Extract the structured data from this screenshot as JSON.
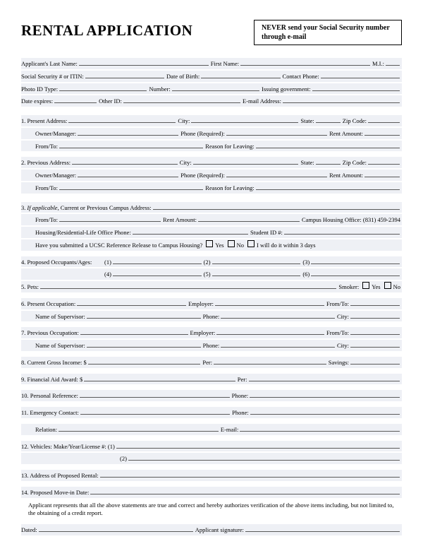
{
  "header": {
    "title": "RENTAL APPLICATION",
    "warning": "NEVER send your Social Security number through e-mail"
  },
  "labels": {
    "last_name": "Applicant's Last Name:",
    "first_name": "First Name:",
    "mi": "M.I.:",
    "ssn": "Social Security # or ITIN:",
    "dob": "Date of Birth:",
    "contact_phone": "Contact Phone:",
    "photo_id": "Photo ID Type:",
    "number": "Number:",
    "issuing_gov": "Issuing government:",
    "date_expires": "Date expires:",
    "other_id": "Other ID:",
    "email": "E-mail Address:",
    "s1": "1. Present Address:",
    "s2": "2. Previous Address:",
    "city": "City:",
    "state": "State:",
    "zip": "Zip Code:",
    "owner_manager": "Owner/Manager:",
    "phone_req": "Phone (Required):",
    "rent_amount": "Rent Amount:",
    "from_to": "From/To:",
    "reason": "Reason for Leaving:",
    "s3_prefix": "3.",
    "s3_italic": " If applicable,",
    "s3_rest": " Current or Previous Campus Address:",
    "campus_office": "Campus Housing Office: (831) 459-2394",
    "housing_phone": "Housing/Residential-Life Office Phone:",
    "student_id": "Student ID #:",
    "ref_release": "Have you submitted a UCSC Reference Release to Campus Housing?",
    "yes": "Yes",
    "no": "No",
    "within3": "I will do it within 3 days",
    "s4": "4. Proposed Occupants/Ages:",
    "occ1": "(1)",
    "occ2": "(2)",
    "occ3": "(3)",
    "occ4": "(4)",
    "occ5": "(5)",
    "occ6": "(6)",
    "s5": "5. Pets:",
    "smoker": "Smoker:",
    "s6": "6. Present Occupation:",
    "s7": "7. Previous Occupation:",
    "employer": "Employer:",
    "supervisor": "Name of Supervisor:",
    "phone": "Phone:",
    "city2": "City:",
    "s8": "8. Current Gross Income: $",
    "per": "Per:",
    "savings": "Savings:",
    "s9": "9. Financial Aid Award: $",
    "s10": "10. Personal Reference:",
    "s11": "11. Emergency Contact:",
    "relation": "Relation:",
    "email2": "E-mail:",
    "s12": "12. Vehicles: Make/Year/License #: (1)",
    "s12b": "(2)",
    "s13": "13. Address of Proposed Rental:",
    "s14": "14. Proposed Move-in Date:",
    "disclaimer": "Applicant represents that all the above statements are true and correct and hereby authorizes verification of the above items including, but not limited to, the obtaining of a credit report.",
    "dated": "Dated:",
    "signature": "Applicant signature:"
  }
}
